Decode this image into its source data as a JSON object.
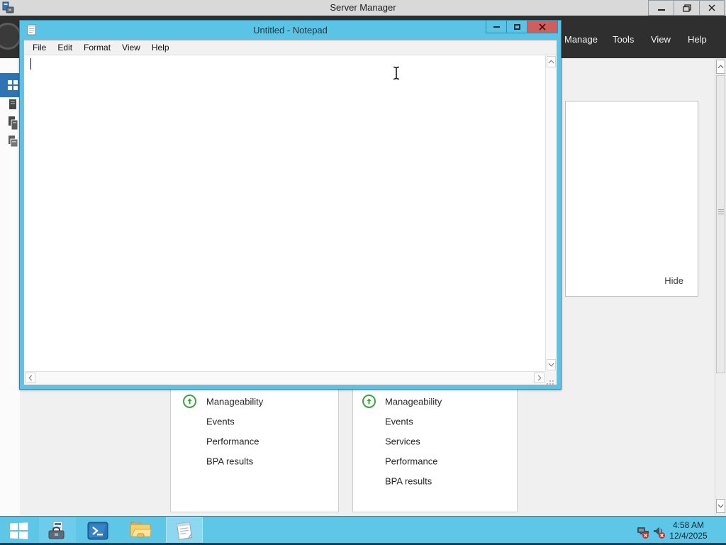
{
  "server_manager": {
    "title": "Server Manager",
    "nav_menu": [
      {
        "label": "Manage"
      },
      {
        "label": "Tools"
      },
      {
        "label": "View"
      },
      {
        "label": "Help"
      }
    ],
    "welcome_tile": {
      "hide_label": "Hide"
    },
    "dashboard_tiles": [
      {
        "status_icon": "green-up-arrow-circle-icon",
        "rows": [
          {
            "label": "Manageability"
          },
          {
            "label": "Events"
          },
          {
            "label": "Performance"
          },
          {
            "label": "BPA results"
          }
        ]
      },
      {
        "status_icon": "green-up-arrow-circle-icon",
        "rows": [
          {
            "label": "Manageability"
          },
          {
            "label": "Events"
          },
          {
            "label": "Services"
          },
          {
            "label": "Performance"
          },
          {
            "label": "BPA results"
          }
        ]
      }
    ]
  },
  "notepad": {
    "title": "Untitled - Notepad",
    "menu": [
      {
        "label": "File"
      },
      {
        "label": "Edit"
      },
      {
        "label": "Format"
      },
      {
        "label": "View"
      },
      {
        "label": "Help"
      }
    ],
    "text_content": ""
  },
  "taskbar": {
    "time": "4:58 AM",
    "date": "12/4/2025"
  },
  "colors": {
    "taskbar_blue": "#5ec6e7",
    "notepad_frame_blue": "#5ac3e6",
    "selected_nav_blue": "#2e74b5",
    "status_green": "#3aa63a",
    "close_button_red": "#d05f5c",
    "navbar_dark": "#2f2f2f"
  }
}
